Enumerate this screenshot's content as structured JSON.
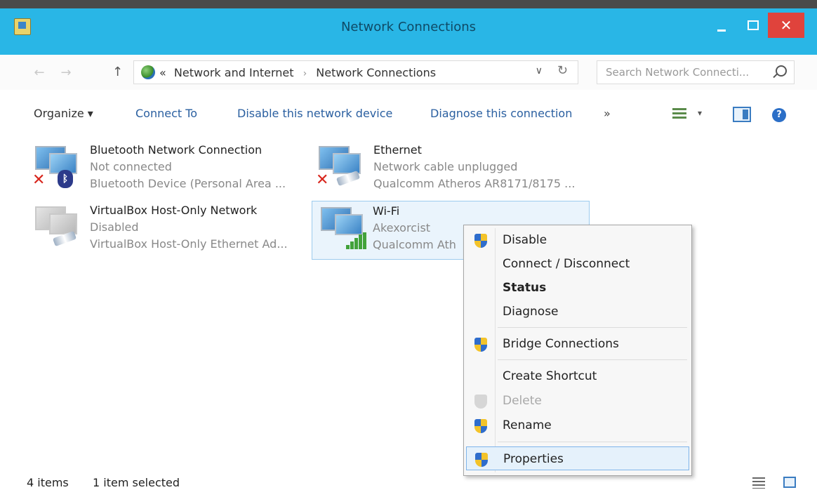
{
  "window": {
    "title": "Network Connections",
    "close_glyph": "✕"
  },
  "address": {
    "prefix": "«",
    "crumb1": "Network and Internet",
    "separator": "›",
    "crumb2": "Network Connections",
    "dropdown_glyph": "∨",
    "refresh_glyph": "↻",
    "back_glyph": "←",
    "forward_glyph": "→",
    "up_glyph": "↑"
  },
  "search": {
    "placeholder": "Search Network Connecti..."
  },
  "toolbar": {
    "organize": "Organize ▾",
    "connect_to": "Connect To",
    "disable_device": "Disable this network device",
    "diagnose": "Diagnose this connection",
    "more": "»",
    "view_drop": "▾",
    "help": "?"
  },
  "connections": [
    {
      "name": "Bluetooth Network Connection",
      "status": "Not connected",
      "device": "Bluetooth Device (Personal Area ...",
      "icon": "bluetooth-network-icon"
    },
    {
      "name": "Ethernet",
      "status": "Network cable unplugged",
      "device": "Qualcomm Atheros AR8171/8175 ...",
      "icon": "ethernet-icon"
    },
    {
      "name": "VirtualBox Host-Only Network",
      "status": "Disabled",
      "device": "VirtualBox Host-Only Ethernet Ad...",
      "icon": "virtualbox-network-icon"
    },
    {
      "name": "Wi-Fi",
      "status": "Akexorcist",
      "device": "Qualcomm Ath",
      "icon": "wifi-network-icon"
    }
  ],
  "badges": {
    "x": "✕",
    "bluetooth": "ᛒ"
  },
  "context_menu": {
    "disable": "Disable",
    "connect_disconnect": "Connect / Disconnect",
    "status": "Status",
    "diagnose": "Diagnose",
    "bridge": "Bridge Connections",
    "create_shortcut": "Create Shortcut",
    "delete": "Delete",
    "rename": "Rename",
    "properties": "Properties"
  },
  "statusbar": {
    "count": "4 items",
    "selected": "1 item selected"
  },
  "colors": {
    "titlebar": "#29b6e6",
    "close": "#e0433c",
    "link": "#2a5fa0",
    "selection": "#eaf4fc"
  }
}
